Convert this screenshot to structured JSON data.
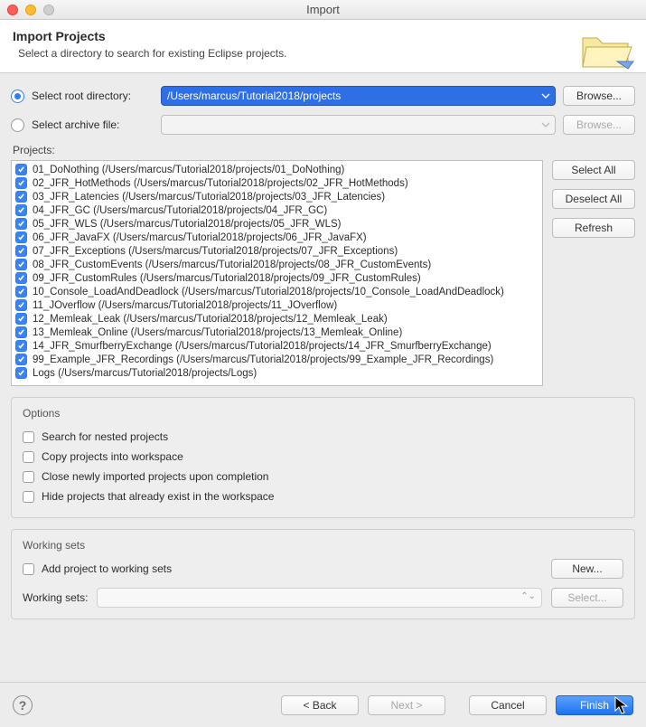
{
  "window": {
    "title": "Import"
  },
  "header": {
    "title": "Import Projects",
    "subtitle": "Select a directory to search for existing Eclipse projects."
  },
  "source": {
    "root_label": "Select root directory:",
    "archive_label": "Select archive file:",
    "root_value": "/Users/marcus/Tutorial2018/projects",
    "archive_value": "",
    "browse": "Browse..."
  },
  "projects_label": "Projects:",
  "side": {
    "select_all": "Select All",
    "deselect_all": "Deselect All",
    "refresh": "Refresh"
  },
  "projects": [
    "01_DoNothing (/Users/marcus/Tutorial2018/projects/01_DoNothing)",
    "02_JFR_HotMethods (/Users/marcus/Tutorial2018/projects/02_JFR_HotMethods)",
    "03_JFR_Latencies (/Users/marcus/Tutorial2018/projects/03_JFR_Latencies)",
    "04_JFR_GC (/Users/marcus/Tutorial2018/projects/04_JFR_GC)",
    "05_JFR_WLS (/Users/marcus/Tutorial2018/projects/05_JFR_WLS)",
    "06_JFR_JavaFX (/Users/marcus/Tutorial2018/projects/06_JFR_JavaFX)",
    "07_JFR_Exceptions (/Users/marcus/Tutorial2018/projects/07_JFR_Exceptions)",
    "08_JFR_CustomEvents (/Users/marcus/Tutorial2018/projects/08_JFR_CustomEvents)",
    "09_JFR_CustomRules (/Users/marcus/Tutorial2018/projects/09_JFR_CustomRules)",
    "10_Console_LoadAndDeadlock (/Users/marcus/Tutorial2018/projects/10_Console_LoadAndDeadlock)",
    "11_JOverflow (/Users/marcus/Tutorial2018/projects/11_JOverflow)",
    "12_Memleak_Leak (/Users/marcus/Tutorial2018/projects/12_Memleak_Leak)",
    "13_Memleak_Online (/Users/marcus/Tutorial2018/projects/13_Memleak_Online)",
    "14_JFR_SmurfberryExchange (/Users/marcus/Tutorial2018/projects/14_JFR_SmurfberryExchange)",
    "99_Example_JFR_Recordings (/Users/marcus/Tutorial2018/projects/99_Example_JFR_Recordings)",
    "Logs (/Users/marcus/Tutorial2018/projects/Logs)"
  ],
  "options": {
    "title": "Options",
    "nested": "Search for nested projects",
    "copy": "Copy projects into workspace",
    "close": "Close newly imported projects upon completion",
    "hide": "Hide projects that already exist in the workspace"
  },
  "ws": {
    "title": "Working sets",
    "add": "Add project to working sets",
    "new": "New...",
    "label": "Working sets:",
    "select": "Select..."
  },
  "footer": {
    "back": "< Back",
    "next": "Next >",
    "cancel": "Cancel",
    "finish": "Finish"
  }
}
